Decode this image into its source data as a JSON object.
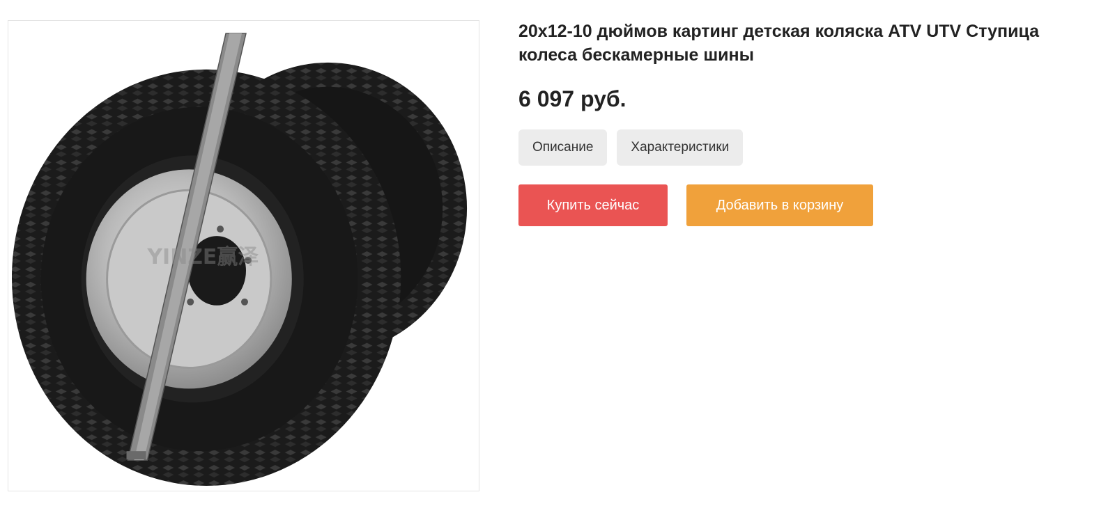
{
  "product": {
    "title": "20x12-10 дюймов картинг детская коляска ATV UTV Ступица колеса бескамерные шины",
    "price": "6 097 руб.",
    "image_watermark": "YINZE赢泽",
    "image_alt": "Шины с колесными дисками"
  },
  "tabs": [
    {
      "label": "Описание"
    },
    {
      "label": "Характеристики"
    }
  ],
  "actions": {
    "buy_now_label": "Купить сейчас",
    "add_to_cart_label": "Добавить в корзину"
  },
  "colors": {
    "buy_button": "#ea5453",
    "cart_button": "#f0a13b",
    "tab_background": "#ececec"
  }
}
